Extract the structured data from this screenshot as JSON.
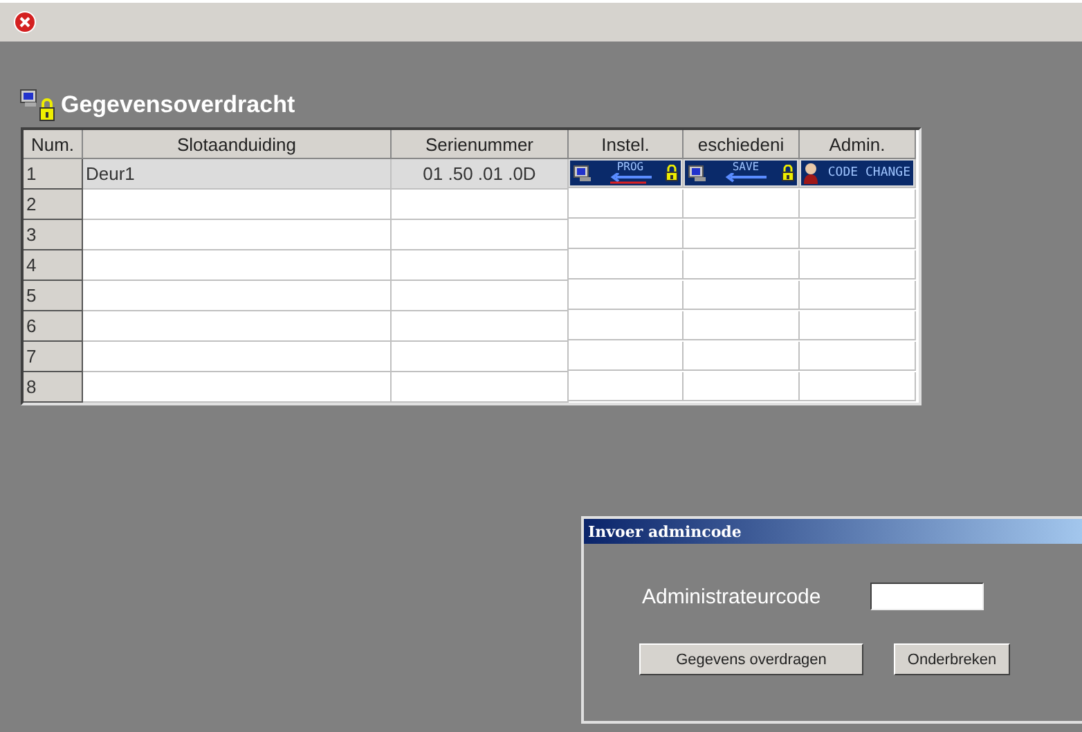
{
  "title": "Gegevensoverdracht",
  "table": {
    "columns": [
      "Num.",
      "Slotaanduiding",
      "Serienummer",
      "Instel.",
      "eschiedeni",
      "Admin."
    ],
    "rows": [
      {
        "num": "1",
        "name": "Deur1",
        "serial": "01 .50 .01 .0D",
        "selected": true,
        "prog": "PROG",
        "save": "SAVE",
        "code": "CODE CHANGE"
      },
      {
        "num": "2",
        "selected": false
      },
      {
        "num": "3",
        "selected": false
      },
      {
        "num": "4",
        "selected": false
      },
      {
        "num": "5",
        "selected": false
      },
      {
        "num": "6",
        "selected": false
      },
      {
        "num": "7",
        "selected": false
      },
      {
        "num": "8",
        "selected": false
      }
    ]
  },
  "dialog": {
    "title": "Invoer admincode",
    "label": "Administrateurcode",
    "buttons": [
      "Gegevens overdragen",
      "Onderbreken"
    ]
  }
}
